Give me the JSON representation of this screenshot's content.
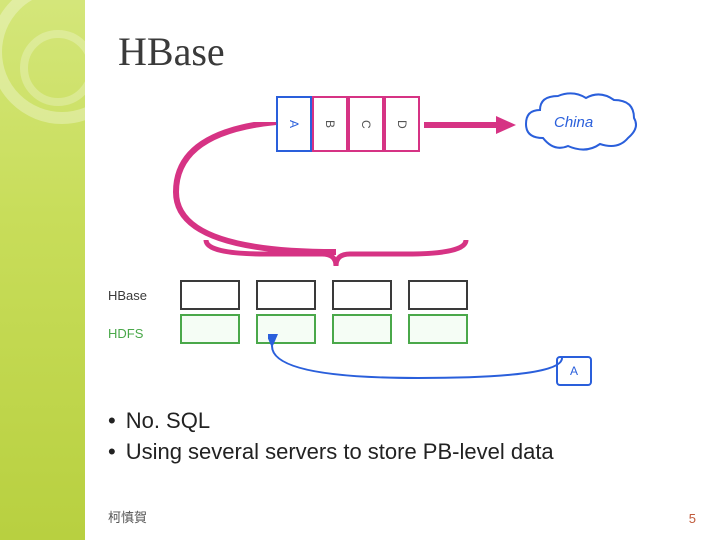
{
  "title": "HBase",
  "diagram": {
    "top_keys": [
      "A",
      "B",
      "C",
      "D"
    ],
    "cloud_label": "China",
    "layer_labels": {
      "hbase": "HBase",
      "hdfs": "HDFS"
    },
    "node_count": 4,
    "detail_box": "A"
  },
  "bullets": [
    "No. SQL",
    "Using several servers to store PB-level data"
  ],
  "footer": {
    "author": "柯慎賀",
    "page": "5"
  }
}
